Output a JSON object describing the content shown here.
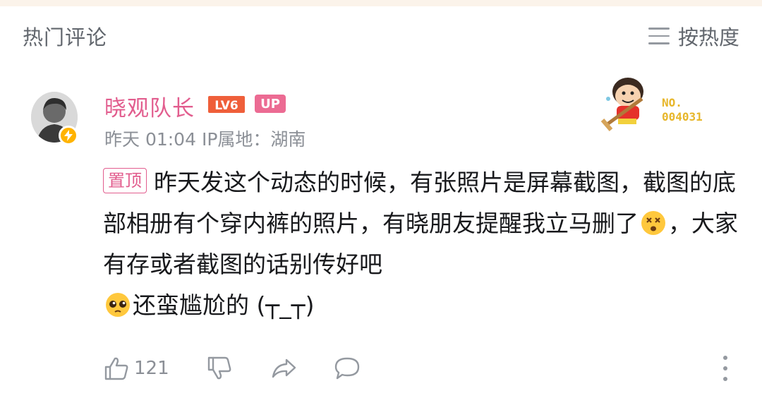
{
  "header": {
    "title": "热门评论",
    "sort_label": "按热度",
    "sort_icon": "list-menu-icon"
  },
  "comment": {
    "username": "晓观队长",
    "level_badge": "LV6",
    "up_badge": "UP",
    "time": "昨天 01:04",
    "ip_location": "IP属地：湖南",
    "decoration_label": "NO.",
    "decoration_number": "004031",
    "pinned_label": "置顶",
    "text_part1": "昨天发这个动态的时候，有张照片是屏幕截图，截图的底部相册有个穿内裤的照片，有晓朋友提醒我立马删了",
    "emoji1": "dizzy-face-emoji",
    "text_part2": "，大家有存或者截图的话别传好吧",
    "emoji2": "pleading-face-emoji",
    "text_part3": "还蛮尴尬的 (┬_┬)",
    "like_count": "121",
    "colors": {
      "username": "#e25d8e",
      "meta": "#8b8f96",
      "vip_badge": "#ffb300",
      "deco_text": "#e7b62a"
    }
  }
}
